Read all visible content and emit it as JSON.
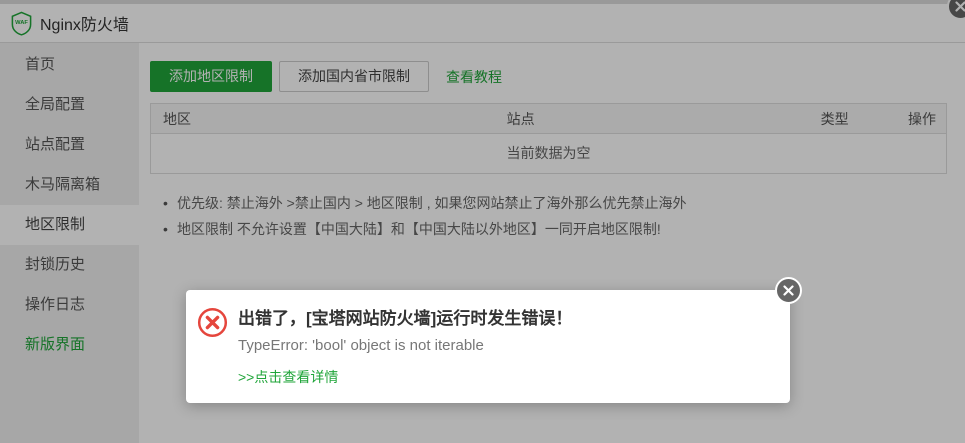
{
  "window": {
    "title": "Nginx防火墙"
  },
  "sidebar": {
    "items": [
      {
        "label": "首页"
      },
      {
        "label": "全局配置"
      },
      {
        "label": "站点配置"
      },
      {
        "label": "木马隔离箱"
      },
      {
        "label": "地区限制"
      },
      {
        "label": "封锁历史"
      },
      {
        "label": "操作日志"
      },
      {
        "label": "新版界面"
      }
    ],
    "active_item": "地区限制"
  },
  "toolbar": {
    "add_region_button": "添加地区限制",
    "add_province_button": "添加国内省市限制",
    "view_tutorial_link": "查看教程"
  },
  "table": {
    "columns": [
      "地区",
      "站点",
      "类型",
      "操作"
    ],
    "empty_text": "当前数据为空"
  },
  "tips": [
    "优先级: 禁止海外 >禁止国内 > 地区限制 , 如果您网站禁止了海外那么优先禁止海外",
    "地区限制 不允许设置【中国大陆】和【中国大陆以外地区】一同开启地区限制!"
  ],
  "modal": {
    "title": "出错了，[宝塔网站防火墙]运行时发生错误！",
    "message": "TypeError: 'bool' object is not iterable",
    "detail_link": ">>点击查看详情"
  },
  "icons": {
    "header": "waf-shield-icon",
    "modal": "error-circle-icon",
    "close": "close-icon"
  },
  "colors": {
    "accent_green": "#20a53a",
    "error_red": "#e5463d",
    "close_button_gray": "#666666"
  }
}
